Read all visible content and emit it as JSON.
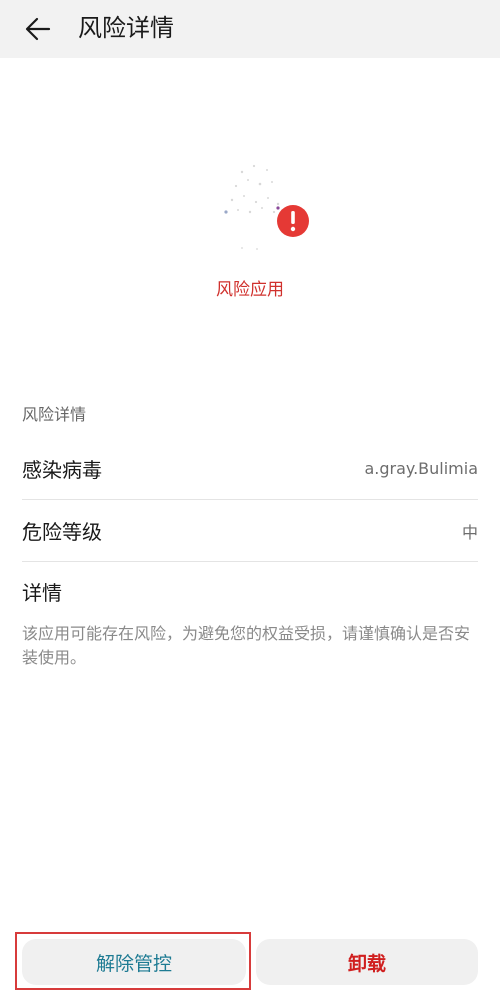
{
  "header": {
    "title": "风险详情",
    "back_icon": "arrow-left-icon"
  },
  "hero": {
    "app_icon": "app-placeholder-icon",
    "badge_icon": "exclamation-circle-icon",
    "badge_color": "#e53935",
    "label": "风险应用",
    "label_color": "#d0312d"
  },
  "details": {
    "section_label": "风险详情",
    "rows": [
      {
        "label": "感染病毒",
        "value": "a.gray.Bulimia"
      },
      {
        "label": "危险等级",
        "value": "中"
      }
    ],
    "detail_title": "详情",
    "detail_text": "该应用可能存在风险，为避免您的权益受损，请谨慎确认是否安装使用。"
  },
  "actions": {
    "unlock_label": "解除管控",
    "uninstall_label": "卸载",
    "unlock_color": "#1e7b93",
    "uninstall_color": "#d01f1f",
    "highlight_color": "#d73b3b"
  }
}
